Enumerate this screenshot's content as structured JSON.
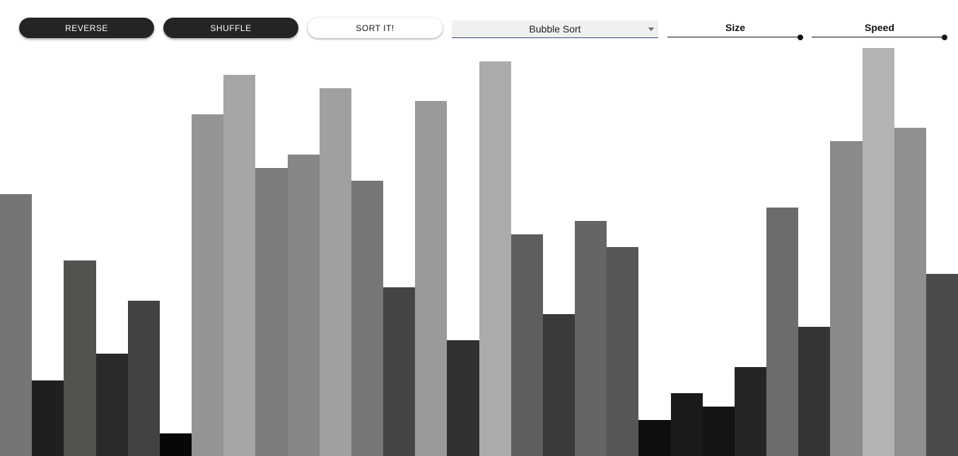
{
  "toolbar": {
    "reverse_label": "REVERSE",
    "shuffle_label": "SHUFFLE",
    "sort_label": "SORT IT!",
    "algorithm_selected": "Bubble Sort",
    "size_label": "Size",
    "speed_label": "Speed",
    "size_value": 1.0,
    "speed_value": 1.0
  },
  "chart_data": {
    "type": "bar",
    "values": [
      371,
      107,
      277,
      145,
      220,
      32,
      484,
      540,
      408,
      427,
      521,
      390,
      239,
      503,
      164,
      559,
      314,
      201,
      333,
      296,
      51,
      89,
      70,
      126,
      352,
      183,
      446,
      578,
      465,
      258
    ],
    "ylim": [
      0,
      646
    ],
    "colors": [
      "#767474",
      "#1f1f1f",
      "#53524f",
      "#2a2a2a",
      "#424242",
      "#070707",
      "#959393",
      "#a7a6a6",
      "#7d7c7c",
      "#878686",
      "#a19f9f",
      "#787777",
      "#454545",
      "#9b9999",
      "#303030",
      "#ababab",
      "#5f5e5e",
      "#3a3a3a",
      "#666464",
      "#575656",
      "#0f0f0f",
      "#1a1a1a",
      "#141414",
      "#252525",
      "#6d6c6c",
      "#353535",
      "#8b8a8a",
      "#b3b3b3",
      "#918f8f",
      "#4b4b4b"
    ]
  }
}
